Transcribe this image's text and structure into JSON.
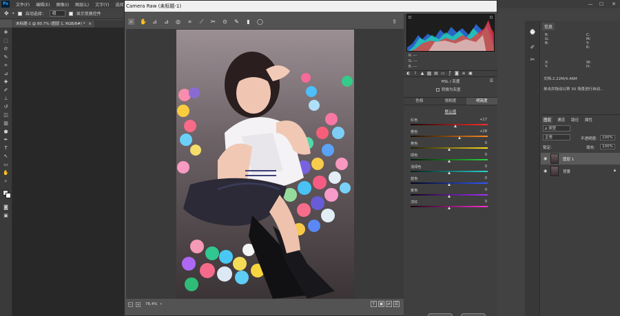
{
  "menubar": {
    "logo": "Ps",
    "items": [
      "文件(F)",
      "编辑(E)",
      "图像(I)",
      "图层(L)",
      "文字(Y)",
      "选择(S)"
    ],
    "controls": [
      "—",
      "☐",
      "✕"
    ]
  },
  "optbar": {
    "auto_select_label": "自动选择：",
    "auto_select_value": "组",
    "show_transform_label": "显示变换控件"
  },
  "document_tab": {
    "label": "未标题-1 @ 80.7% (图层 1, RGB/8#) *",
    "close": "×"
  },
  "camera_raw": {
    "title": "Camera Raw (未标题-1)",
    "zoom": "76.4%",
    "tools": [
      "zoom-icon",
      "hand-icon",
      "white-balance-icon",
      "color-sampler-icon",
      "target-adjust-icon",
      "crop-icon",
      "straighten-icon",
      "spot-removal-icon",
      "red-eye-icon",
      "adjustment-brush-icon",
      "graduated-filter-icon",
      "radial-filter-icon"
    ],
    "readout": {
      "r_label": "R:",
      "g_label": "G:",
      "b_label": "B:",
      "r": "---",
      "g": "---",
      "b": "---"
    },
    "panel_title": "HSL / 灰度",
    "grayscale_label": "转换为灰度",
    "sub_tabs": [
      "色相",
      "饱和度",
      "明亮度"
    ],
    "active_sub_tab": 2,
    "defaults_label": "默认值",
    "sliders": [
      {
        "label": "红色",
        "value": "+17",
        "pos": 0.585,
        "gradient": "linear-gradient(90deg,#1a0505,#ff2b2b)"
      },
      {
        "label": "橙色",
        "value": "+28",
        "pos": 0.64,
        "gradient": "linear-gradient(90deg,#1a0d02,#ff8a1e)"
      },
      {
        "label": "黄色",
        "value": "0",
        "pos": 0.5,
        "gradient": "linear-gradient(90deg,#1a1a02,#ffe11e)"
      },
      {
        "label": "绿色",
        "value": "0",
        "pos": 0.5,
        "gradient": "linear-gradient(90deg,#021a04,#2bd63a)"
      },
      {
        "label": "浅绿色",
        "value": "0",
        "pos": 0.5,
        "gradient": "linear-gradient(90deg,#021a1a,#26d6cf)"
      },
      {
        "label": "蓝色",
        "value": "0",
        "pos": 0.5,
        "gradient": "linear-gradient(90deg,#02051a,#2f58ff)"
      },
      {
        "label": "紫色",
        "value": "0",
        "pos": 0.5,
        "gradient": "linear-gradient(90deg,#0e021a,#a52fff)"
      },
      {
        "label": "洋红",
        "value": "0",
        "pos": 0.5,
        "gradient": "linear-gradient(90deg,#1a0214,#ff2fd1)"
      }
    ]
  },
  "info_panel": {
    "tab": "信息",
    "doc_size": "文档:2.22M/4.46M",
    "hint": "单击并拖动以移 30 场景进行自动..."
  },
  "layers_panel": {
    "tabs": [
      "图层",
      "通道",
      "路径",
      "属性"
    ],
    "kind_label": "ρ 类型",
    "blend_mode": "正常",
    "opacity_label": "不透明度:",
    "opacity_value": "100%",
    "lock_label": "锁定:",
    "fill_label": "填充:",
    "fill_value": "100%",
    "layers": [
      {
        "name": "图层 1"
      },
      {
        "name": "背景"
      }
    ]
  }
}
